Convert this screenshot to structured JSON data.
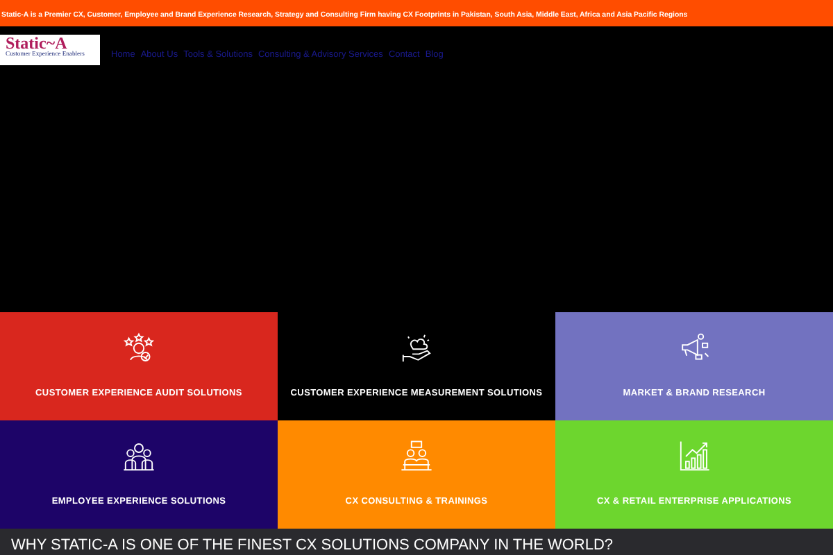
{
  "topbar": {
    "text": "Static-A is a Premier CX, Customer, Employee and Brand Experience Research, Strategy and Consulting Firm having CX Footprints in Pakistan, South Asia, Middle East, Africa and Asia Pacific Regions"
  },
  "logo": {
    "name": "Static~A",
    "tagline": "Customer Experience Enablers"
  },
  "nav": [
    "Home",
    "About Us",
    "Tools & Solutions",
    "Consulting & Advisory Services",
    "Contact",
    "Blog"
  ],
  "tiles": [
    {
      "label": "CUSTOMER EXPERIENCE AUDIT SOLUTIONS",
      "color": "#d9271e"
    },
    {
      "label": "CUSTOMER EXPERIENCE MEASUREMENT SOLUTIONS",
      "color": "#000000"
    },
    {
      "label": "MARKET & BRAND RESEARCH",
      "color": "#7272c0"
    },
    {
      "label": "EMPLOYEE EXPERIENCE SOLUTIONS",
      "color": "#1d0468"
    },
    {
      "label": "CX CONSULTING & TRAININGS",
      "color": "#ff8a00"
    },
    {
      "label": "CX & RETAIL ENTERPRISE APPLICATIONS",
      "color": "#6dd62e"
    }
  ],
  "banner": {
    "heading": "WHY STATIC-A IS ONE OF THE FINEST CX SOLUTIONS COMPANY IN THE WORLD?"
  }
}
